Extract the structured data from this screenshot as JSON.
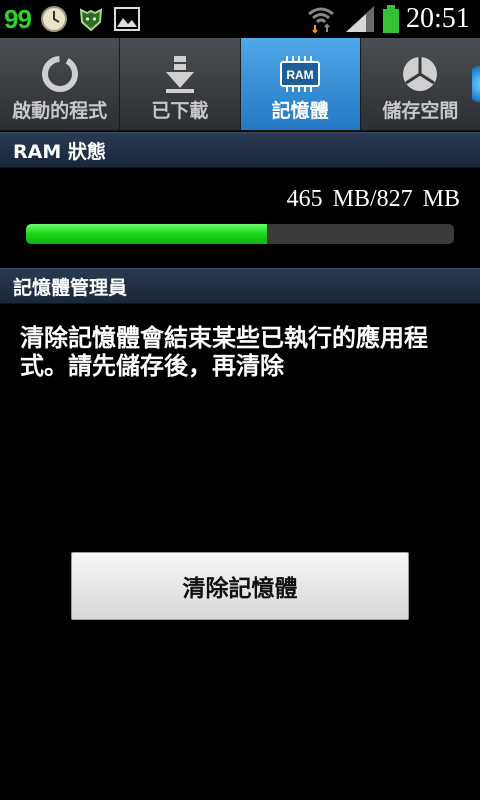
{
  "status_bar": {
    "badge": "99",
    "time": "20:51",
    "icons": [
      "clock-icon",
      "tiger-app-icon",
      "image-icon",
      "wifi-icon",
      "signal-icon",
      "battery-icon"
    ],
    "accent_color": "#27d627"
  },
  "tabs": [
    {
      "label": "啟動的程式",
      "icon": "running-apps-icon",
      "active": false
    },
    {
      "label": "已下載",
      "icon": "download-icon",
      "active": false
    },
    {
      "label": "記憶體",
      "icon": "ram-chip-icon",
      "icon_text": "RAM",
      "active": true
    },
    {
      "label": "儲存空間",
      "icon": "storage-pie-icon",
      "active": false
    }
  ],
  "ram_section": {
    "header": "RAM  狀態",
    "usage_text": "465  MB/827  MB",
    "used_mb": 465,
    "total_mb": 827,
    "progress_fraction": 0.5623
  },
  "manager_section": {
    "header": "記憶體管理員",
    "description": "清除記憶體會結束某些已執行的應用程式。請先儲存後，再清除",
    "clear_button": "清除記憶體"
  },
  "colors": {
    "tab_active": "#2379c3",
    "progress_green": "#19d419",
    "section_header": "#1b2738"
  }
}
